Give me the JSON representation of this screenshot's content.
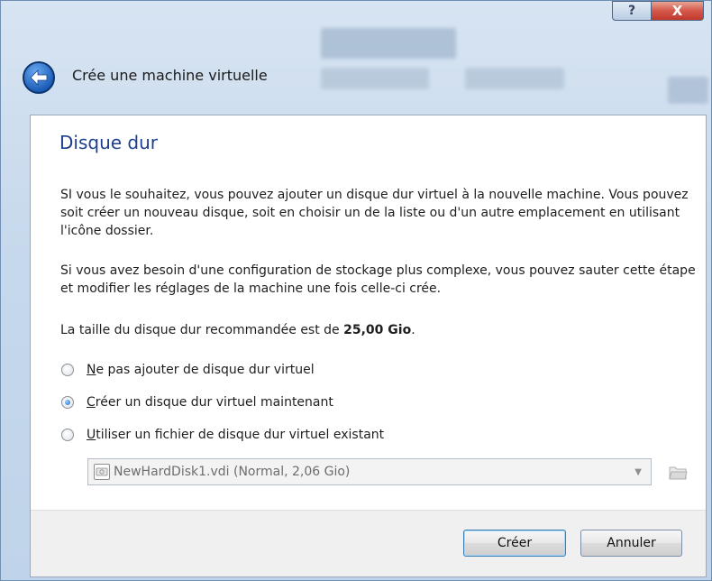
{
  "window": {
    "title": "Crée une machine virtuelle",
    "caption": {
      "help_glyph": "?",
      "close_glyph": "X"
    }
  },
  "page": {
    "heading": "Disque dur",
    "paragraph1": "SI vous le souhaitez, vous pouvez ajouter un disque dur virtuel à la nouvelle machine. Vous pouvez soit créer un nouveau disque, soit en choisir un de la liste ou d'un autre emplacement en utilisant l'icône dossier.",
    "paragraph2": "Si vous avez besoin d'une configuration de stockage plus complexe, vous pouvez sauter cette étape et modifier les réglages de la machine une fois celle-ci crée.",
    "recommended_prefix": "La taille du disque dur recommandée est de ",
    "recommended_size": "25,00 Gio",
    "recommended_suffix": "."
  },
  "options": [
    {
      "mnemonic": "N",
      "label_rest": "e pas ajouter de disque dur virtuel",
      "selected": false
    },
    {
      "mnemonic": "C",
      "label_rest": "réer un disque dur virtuel maintenant",
      "selected": true
    },
    {
      "mnemonic": "U",
      "label_rest": "tiliser un fichier de disque dur virtuel existant",
      "selected": false
    }
  ],
  "existing_disk": {
    "selected_value": "NewHardDisk1.vdi (Normal, 2,06 Gio)",
    "enabled": false
  },
  "buttons": {
    "create": "Créer",
    "cancel": "Annuler"
  },
  "colors": {
    "heading": "#1d3f8c",
    "accent_blue": "#1d5fb8",
    "close_red": "#c13a2d"
  },
  "icons": {
    "back": "back-arrow-icon",
    "disk": "hard-disk-icon",
    "folder": "folder-icon",
    "dropdown": "chevron-down-icon"
  }
}
